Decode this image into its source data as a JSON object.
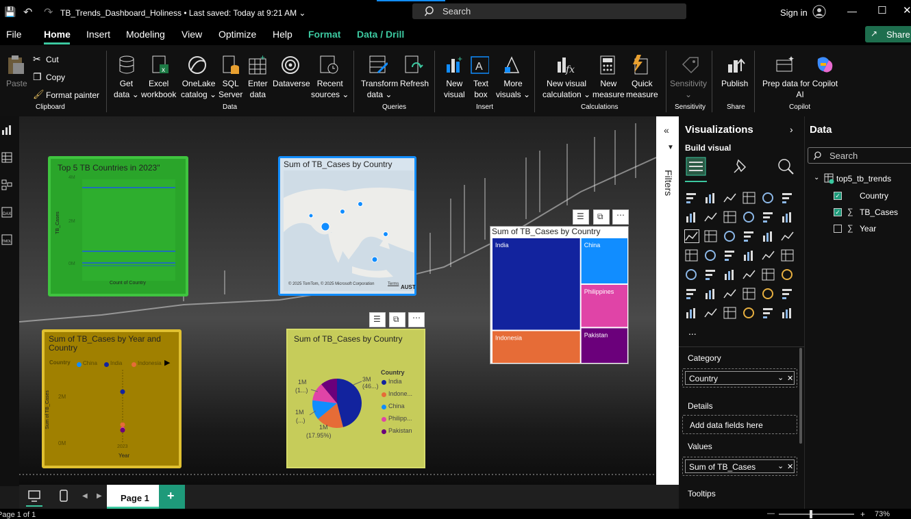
{
  "titlebar": {
    "file_title": "TB_Trends_Dashboard_Holiness",
    "saved": "• Last saved: Today at 9:21 AM",
    "search": "Search",
    "sign_in": "Sign in",
    "share": "Share"
  },
  "menu": {
    "file": "File",
    "home": "Home",
    "insert": "Insert",
    "modeling": "Modeling",
    "view": "View",
    "optimize": "Optimize",
    "help": "Help",
    "format": "Format",
    "data_drill": "Data / Drill"
  },
  "ribbon": {
    "paste": "Paste",
    "cut": "Cut",
    "copy": "Copy",
    "format_painter": "Format painter",
    "clipboard": "Clipboard",
    "get_data": "Get\ndata ⌄",
    "excel": "Excel\nworkbook",
    "onelake": "OneLake\ncatalog ⌄",
    "sql": "SQL\nServer",
    "enter": "Enter\ndata",
    "dataverse": "Dataverse",
    "recent": "Recent\nsources ⌄",
    "data_group": "Data",
    "transform": "Transform\ndata ⌄",
    "refresh": "Refresh",
    "queries": "Queries",
    "new_visual": "New\nvisual",
    "text_box": "Text\nbox",
    "more_visuals": "More\nvisuals ⌄",
    "insert_group": "Insert",
    "new_calc": "New visual\ncalculation ⌄",
    "new_measure": "New\nmeasure",
    "quick_measure": "Quick\nmeasure",
    "calculations": "Calculations",
    "sensitivity": "Sensitivity\n⌄",
    "sensitivity_group": "Sensitivity",
    "publish": "Publish",
    "share_group": "Share",
    "copilot_prep": "Prep data for Copilot\nAI",
    "copilot_group": "Copilot"
  },
  "visuals": {
    "green": {
      "title": "Top 5 TB Countries in 2023\"",
      "ylabel": "TB_Cases",
      "xlabel": "Count of Country",
      "ticks": [
        "4M",
        "2M",
        "0M"
      ]
    },
    "map": {
      "title": "Sum of TB_Cases by Country",
      "credit": "© 2025 TomTom, © 2025 Microsoft Corporation",
      "terms": "Terms",
      "corner": "AUST"
    },
    "treemap": {
      "title": "Sum of TB_Cases by Country"
    },
    "scatter": {
      "title": "Sum of TB_Cases by Year and Country",
      "legend_label": "Country",
      "ylabel": "Sum of TB_Cases",
      "xlabel": "Year",
      "ytick_top": "2M",
      "ytick_bottom": "0M",
      "xtick": "2023"
    },
    "pie": {
      "title": "Sum of TB_Cases by Country",
      "legend_title": "Country",
      "labels": [
        {
          "t": "3M"
        },
        {
          "t": "(46...)"
        },
        {
          "t": "1M"
        },
        {
          "t": "(1...)"
        },
        {
          "t": "1M"
        },
        {
          "t": "(...)"
        },
        {
          "t": "1M"
        },
        {
          "t": "(17.95%)"
        }
      ]
    }
  },
  "chart_data": [
    {
      "type": "treemap",
      "title": "Sum of TB_Cases by Country",
      "categories": [
        "India",
        "China",
        "Philippines",
        "Indonesia",
        "Pakistan"
      ],
      "values": [
        2.8,
        0.75,
        0.7,
        1.0,
        0.58
      ],
      "colors": [
        "#12239e",
        "#118dff",
        "#e044a7",
        "#e66c37",
        "#6b007b"
      ]
    },
    {
      "type": "pie",
      "title": "Sum of TB_Cases by Country",
      "categories": [
        "India",
        "Indonesia",
        "China",
        "Philippines",
        "Pakistan"
      ],
      "legend": [
        "India",
        "Indone...",
        "China",
        "Philipp...",
        "Pakistan"
      ],
      "values": [
        46,
        17.95,
        13,
        12,
        11
      ],
      "colors": [
        "#12239e",
        "#e66c37",
        "#118dff",
        "#e044a7",
        "#6b007b"
      ]
    },
    {
      "type": "scatter",
      "title": "Sum of TB_Cases by Year and Country",
      "legend": [
        "China",
        "India",
        "Indonesia"
      ],
      "colors": [
        "#118dff",
        "#12239e",
        "#e66c37"
      ],
      "points": [
        {
          "country": "India",
          "x": 2023,
          "y": 2.8
        },
        {
          "country": "Indonesia",
          "x": 2023,
          "y": 1.0
        },
        {
          "country": "Philippines",
          "x": 2023,
          "y": 0.75
        },
        {
          "country": "Pakistan",
          "x": 2023,
          "y": 0.7
        }
      ],
      "ylim": [
        0,
        4
      ]
    }
  ],
  "filters": {
    "label": "Filters"
  },
  "viz": {
    "title": "Visualizations",
    "build": "Build visual",
    "category": "Category",
    "category_field": "Country",
    "details": "Details",
    "details_hint": "Add data fields here",
    "values": "Values",
    "values_field": "Sum of TB_Cases",
    "tooltips": "Tooltips",
    "more": "..."
  },
  "data": {
    "title": "Data",
    "search": "Search",
    "table": "top5_tb_trends",
    "fields": [
      {
        "name": "Country",
        "checked": true,
        "sigma": ""
      },
      {
        "name": "TB_Cases",
        "checked": true,
        "sigma": "∑"
      },
      {
        "name": "Year",
        "checked": false,
        "sigma": "∑"
      }
    ]
  },
  "pages": {
    "page1": "Page 1",
    "add": "+"
  },
  "status": {
    "page": "Page 1 of 1",
    "zoom": "73%"
  }
}
